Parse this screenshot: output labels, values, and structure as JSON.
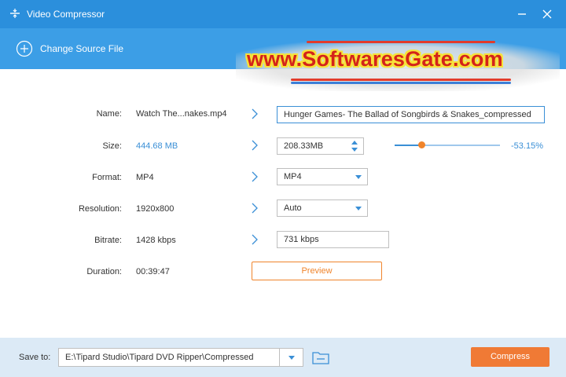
{
  "window": {
    "title": "Video Compressor",
    "app_icon": "compress-icon"
  },
  "toolbar": {
    "change_source_label": "Change Source File"
  },
  "watermark": {
    "text": "www.SoftwaresGate.com"
  },
  "fields": {
    "name": {
      "label": "Name:",
      "original": "Watch The...nakes.mp4",
      "value": "Hunger Games- The Ballad of Songbirds & Snakes_compressed"
    },
    "size": {
      "label": "Size:",
      "original": "444.68 MB",
      "value": "208.33MB",
      "slider_fraction": 0.25,
      "percent": "-53.15%"
    },
    "format": {
      "label": "Format:",
      "original": "MP4",
      "value": "MP4"
    },
    "resolution": {
      "label": "Resolution:",
      "original": "1920x800",
      "value": "Auto"
    },
    "bitrate": {
      "label": "Bitrate:",
      "original": "1428 kbps",
      "value": "731 kbps"
    },
    "duration": {
      "label": "Duration:",
      "original": "00:39:47"
    }
  },
  "preview_label": "Preview",
  "footer": {
    "save_to_label": "Save to:",
    "path": "E:\\Tipard Studio\\Tipard DVD Ripper\\Compressed",
    "compress_label": "Compress"
  },
  "colors": {
    "titlebar": "#2b8fdc",
    "toolbar": "#3c9ee6",
    "accent": "#3a8fd6",
    "orange": "#f07a35"
  }
}
